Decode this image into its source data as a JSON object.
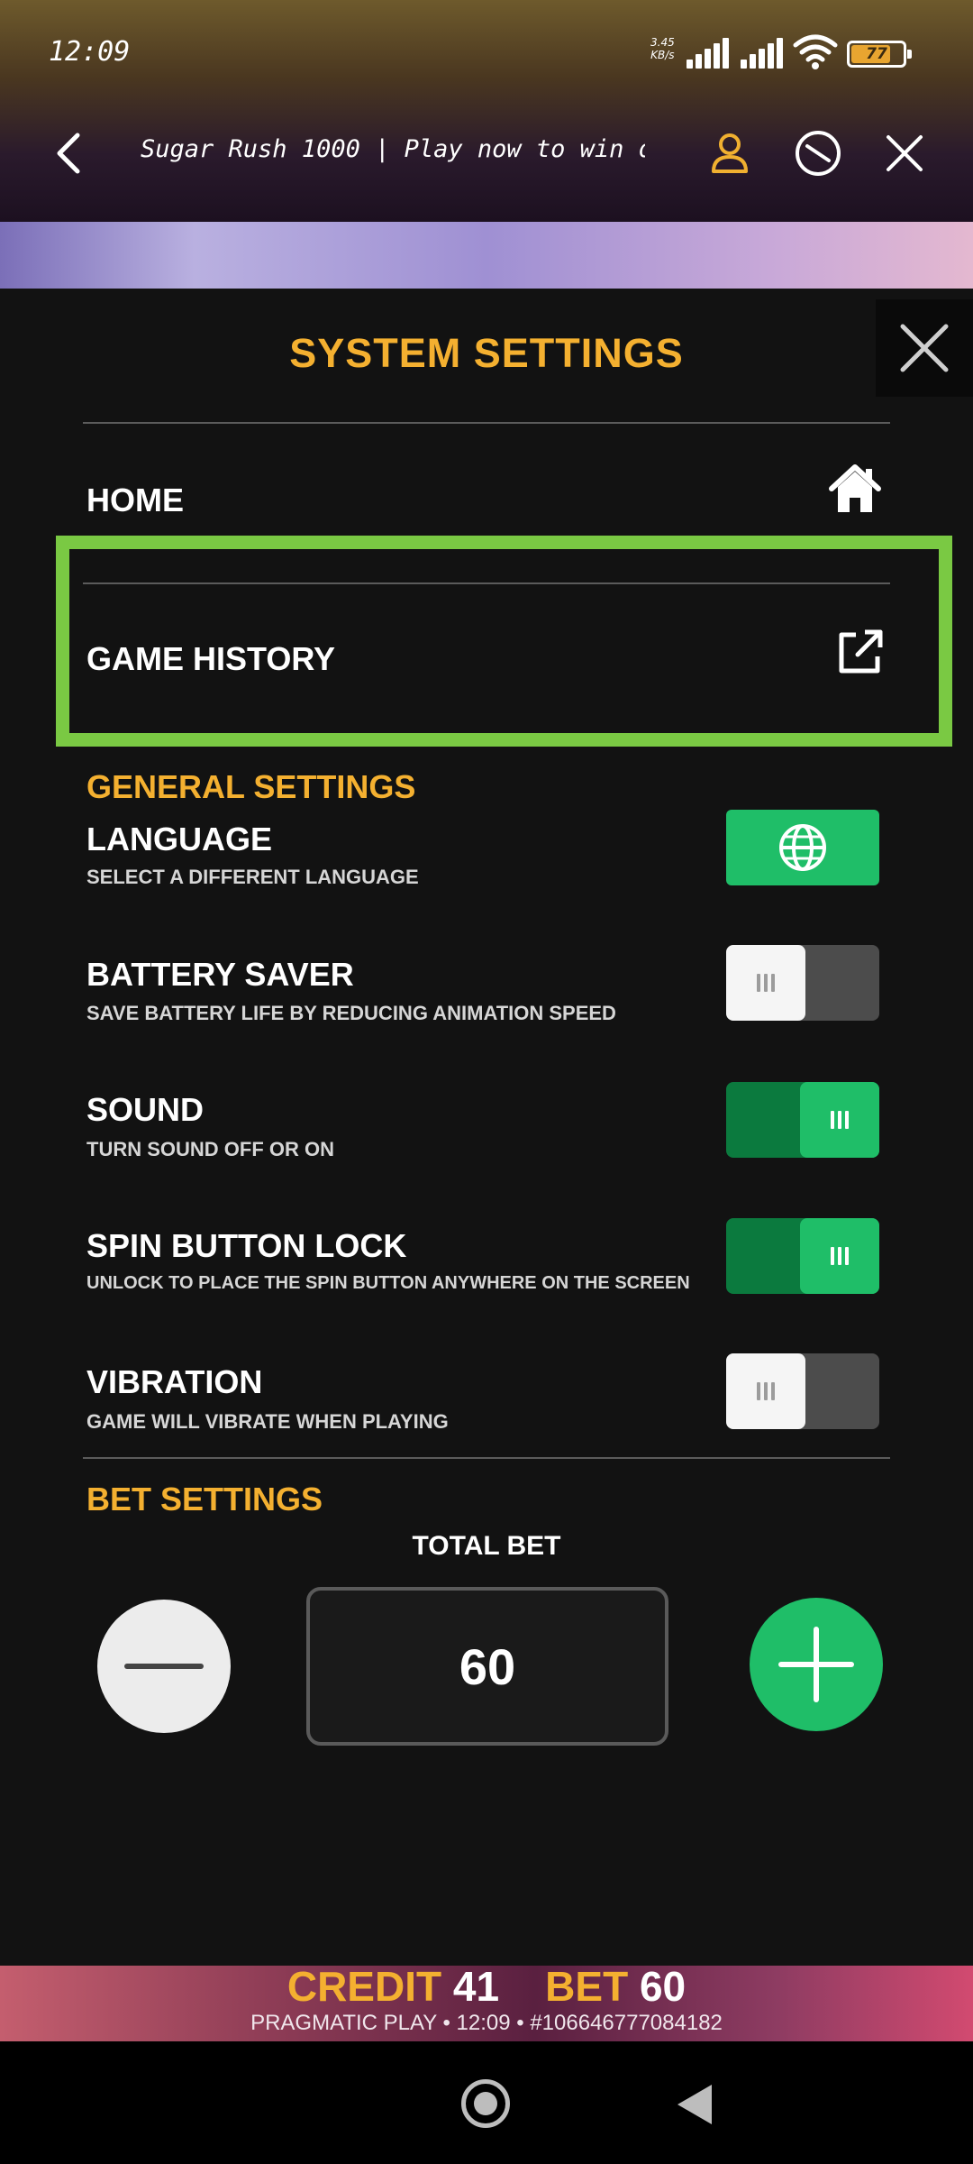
{
  "status_bar": {
    "time": "12:09",
    "net_speed_value": "3.45",
    "net_speed_unit": "KB/s",
    "battery": "77",
    "battery_level": 0.77
  },
  "browser": {
    "title": "Sugar Rush 1000 | Play now to win on...",
    "icons": [
      "back-arrow-icon",
      "user-icon",
      "refresh-icon",
      "close-icon"
    ]
  },
  "settings": {
    "title": "SYSTEM SETTINGS",
    "menu": {
      "home_label": "HOME",
      "game_history_label": "GAME HISTORY"
    },
    "general": {
      "heading": "GENERAL SETTINGS",
      "language": {
        "label": "LANGUAGE",
        "sub": "SELECT A DIFFERENT LANGUAGE"
      },
      "battery_saver": {
        "label": "BATTERY SAVER",
        "sub": "SAVE BATTERY LIFE BY REDUCING ANIMATION SPEED",
        "on": false
      },
      "sound": {
        "label": "SOUND",
        "sub": "TURN SOUND OFF OR ON",
        "on": true
      },
      "spin_lock": {
        "label": "SPIN BUTTON LOCK",
        "sub": "UNLOCK TO PLACE THE SPIN BUTTON ANYWHERE ON THE SCREEN",
        "on": true
      },
      "vibration": {
        "label": "VIBRATION",
        "sub": "GAME WILL VIBRATE WHEN PLAYING",
        "on": false
      }
    },
    "bet": {
      "heading": "BET SETTINGS",
      "total_bet_label": "TOTAL BET",
      "total_bet_value": "60"
    }
  },
  "footer": {
    "credit_label": "CREDIT",
    "credit_value": "41",
    "bet_label": "BET",
    "bet_value": "60",
    "info": "PRAGMATIC PLAY • 12:09 • #106646777084182"
  },
  "colors": {
    "accent_gold": "#f4b030",
    "toggle_green": "#1fbe68",
    "highlight_green": "#7ac943"
  }
}
